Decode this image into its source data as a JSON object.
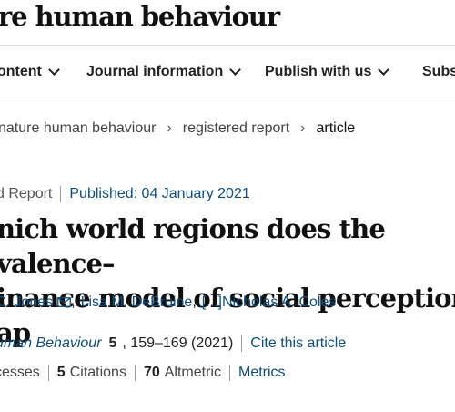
{
  "header": {
    "brand": "re human behaviour"
  },
  "nav": {
    "items": [
      {
        "label": "ontent"
      },
      {
        "label": "Journal information"
      },
      {
        "label": "Publish with us"
      },
      {
        "label": "Subs"
      }
    ]
  },
  "breadcrumb": {
    "items": [
      "nature human behaviour",
      "registered report",
      "article"
    ],
    "separator": "›"
  },
  "article": {
    "type_label": "d Report",
    "published": "Published: 04 January 2021",
    "title_line1": "nich world regions does the valence–",
    "title_line2": "inance model of social perception ap",
    "authors": [
      {
        "name": "C. Jones",
        "email_icon": "mail-icon"
      },
      {
        "name": "Lisa M. DeBruine"
      },
      {
        "name": "[...]Nicholas A. Coles"
      }
    ],
    "citation": {
      "journal": "uman Behaviour",
      "volume": "5",
      "pages": ", 159–169 (2021)",
      "cite_link": "Cite this article"
    },
    "metrics": {
      "accesses_label": "cesses",
      "citations_count": "5",
      "citations_label": "Citations",
      "altmetric_count": "70",
      "altmetric_label": "Altmetric",
      "metrics_link": "Metrics"
    }
  },
  "colors": {
    "link": "#0e4f7f",
    "text": "#222222",
    "rule": "#dcdcdc"
  }
}
